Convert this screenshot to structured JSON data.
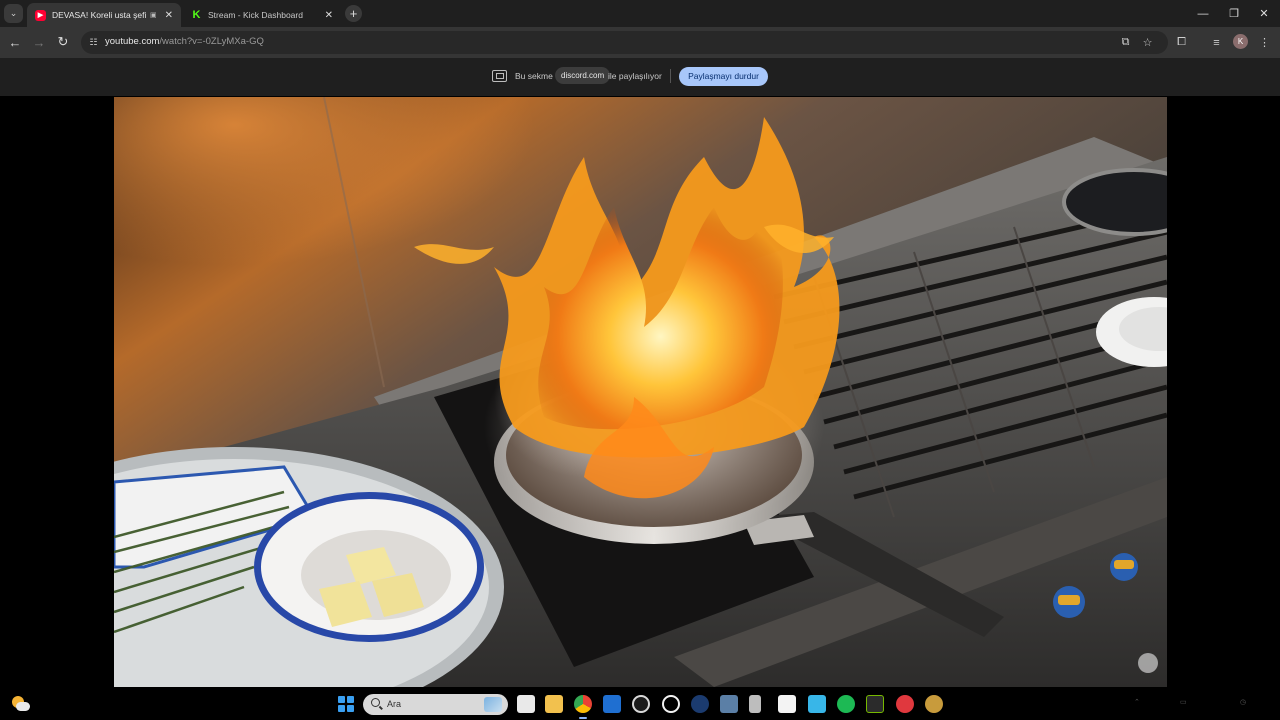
{
  "tabs": [
    {
      "title": "DEVASA! Koreli usta şefin s",
      "favicon": "youtube-icon",
      "active": true
    },
    {
      "title": "Stream - Kick Dashboard",
      "favicon": "kick-icon",
      "active": false
    }
  ],
  "toolbar": {
    "url_host": "youtube.com",
    "url_path": "/watch?v=-0ZLyMXa-GQ"
  },
  "sharebar": {
    "prefix": "Bu sekme",
    "site": "discord.com",
    "suffix": "ile paylaşılıyor",
    "stop_label": "Paylaşmayı durdur"
  },
  "profile": {
    "initial": "K"
  },
  "taskbar": {
    "search_placeholder": "Ara",
    "apps": [
      "task-view-icon",
      "file-explorer-icon",
      "chrome-icon",
      "outlook-icon",
      "obs-icon",
      "app-o-icon",
      "steam-icon",
      "calculator-icon",
      "usb-drive-icon",
      "slides-icon",
      "notepad-icon",
      "spotify-icon",
      "nvidia-icon",
      "riot-icon",
      "league-icon"
    ]
  },
  "colors": {
    "chrome_dark": "#1f1f1f",
    "toolbar": "#353535",
    "accent_button": "#a8c7fa",
    "youtube_red": "#ff0033",
    "kick_green": "#53fc18"
  }
}
